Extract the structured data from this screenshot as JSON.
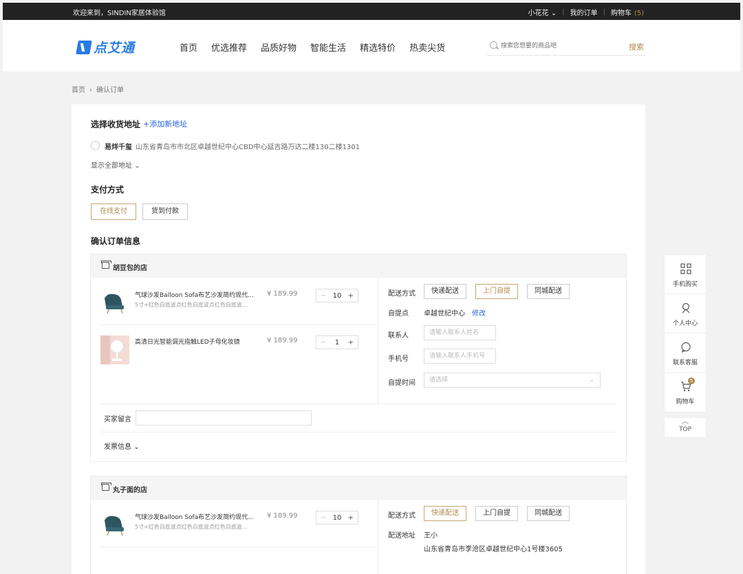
{
  "topbar": {
    "welcome": "欢迎来到，SINDIN家居体验馆",
    "user": "小花花",
    "orders": "我的订单",
    "cart": "购物车",
    "cart_count": "(5)"
  },
  "header": {
    "logo": "点艾通",
    "nav": [
      "首页",
      "优选推荐",
      "品质好物",
      "智能生活",
      "精选特价",
      "热卖尖货"
    ],
    "search_placeholder": "搜索您想要的商品吧",
    "search_btn": "搜索"
  },
  "breadcrumb": {
    "home": "首页",
    "current": "确认订单"
  },
  "address": {
    "title": "选择收货地址",
    "add": "+添加新地址",
    "name": "易烊千玺",
    "detail": "山东省青岛市市北区卓越世纪中心CBD中心延吉路万达二楼130二楼1301",
    "show_all": "显示全部地址"
  },
  "payment": {
    "title": "支付方式",
    "online": "在线支付",
    "cod": "货到付款"
  },
  "confirm_title": "确认订单信息",
  "store1": {
    "name": "胡豆包的店",
    "items": [
      {
        "title": "气球沙发Balloon Sofa布艺沙发简约现代...",
        "sub": "5寸+红色白底波点红色白底波点红色白底波...",
        "price": "¥ 189.99",
        "qty": "10"
      },
      {
        "title": "高清日光智能调光指触LED子母化妆镜",
        "sub": "",
        "price": "¥ 189.99",
        "qty": "1"
      }
    ],
    "delivery_label": "配送方式",
    "delivery_opts": [
      "快递配送",
      "上门自提",
      "同城配送"
    ],
    "pickup_label": "自提点",
    "pickup_value": "卓越世纪中心",
    "modify": "修改",
    "contact_label": "联系人",
    "contact_placeholder": "请输入联系人姓名",
    "phone_label": "手机号",
    "phone_placeholder": "请输入联系人手机号",
    "time_label": "自提时间",
    "time_placeholder": "请选择",
    "note_label": "买家留言",
    "invoice_label": "发票信息"
  },
  "store2": {
    "name": "丸子面的店",
    "items": [
      {
        "title": "气球沙发Balloon Sofa布艺沙发简约现代...",
        "sub": "5寸+红色白底波点红色白底波点红色白底波...",
        "price": "¥ 189.99",
        "qty": "10"
      }
    ],
    "delivery_label": "配送方式",
    "delivery_opts": [
      "快递配送",
      "上门自提",
      "同城配送"
    ],
    "addr_label": "配送地址",
    "addr_name": "王小",
    "addr_detail": "山东省青岛市李沧区卓越世纪中心1号楼3605"
  },
  "floatbar": {
    "mobile": "手机购买",
    "me": "个人中心",
    "service": "联系客服",
    "cart": "购物车",
    "cart_badge": "5",
    "top": "TOP"
  },
  "colors": {
    "accent": "#b08a4f",
    "link": "#2a64d8",
    "brand": "#2a7be4"
  }
}
